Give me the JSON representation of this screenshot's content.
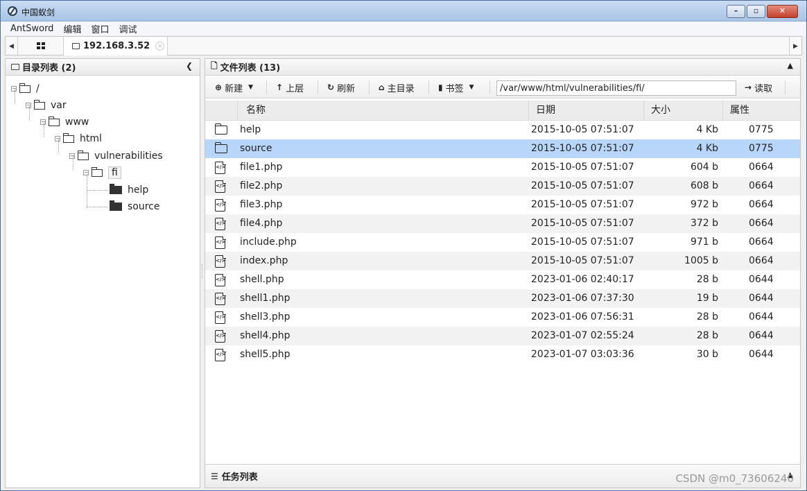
{
  "window": {
    "title": "中国蚁剑"
  },
  "menu": [
    "AntSword",
    "编辑",
    "窗口",
    "调试"
  ],
  "tabs": {
    "active_label": "192.168.3.52"
  },
  "tree_panel": {
    "title": "目录列表 (2)",
    "nodes": [
      {
        "label": "/",
        "depth": 0
      },
      {
        "label": "var",
        "depth": 1
      },
      {
        "label": "www",
        "depth": 2
      },
      {
        "label": "html",
        "depth": 3
      },
      {
        "label": "vulnerabilities",
        "depth": 4
      },
      {
        "label": "fi",
        "depth": 5
      },
      {
        "label": "help",
        "depth": 6
      },
      {
        "label": "source",
        "depth": 6
      }
    ]
  },
  "file_panel": {
    "title": "文件列表 (13)",
    "toolbar": {
      "new_label": "新建",
      "up_label": "上层",
      "refresh_label": "刷新",
      "home_label": "主目录",
      "bookmark_label": "书签",
      "path_value": "/var/www/html/vulnerabilities/fi/",
      "read_label": "读取"
    },
    "columns": [
      "名称",
      "日期",
      "大小",
      "属性"
    ],
    "files": [
      {
        "type": "folder",
        "name": "help",
        "date": "2015-10-05 07:51:07",
        "size": "4 Kb",
        "attr": "0775"
      },
      {
        "type": "folder",
        "name": "source",
        "date": "2015-10-05 07:51:07",
        "size": "4 Kb",
        "attr": "0775",
        "selected": true
      },
      {
        "type": "file",
        "name": "file1.php",
        "date": "2015-10-05 07:51:07",
        "size": "604 b",
        "attr": "0664"
      },
      {
        "type": "file",
        "name": "file2.php",
        "date": "2015-10-05 07:51:07",
        "size": "608 b",
        "attr": "0664"
      },
      {
        "type": "file",
        "name": "file3.php",
        "date": "2015-10-05 07:51:07",
        "size": "972 b",
        "attr": "0664"
      },
      {
        "type": "file",
        "name": "file4.php",
        "date": "2015-10-05 07:51:07",
        "size": "372 b",
        "attr": "0664"
      },
      {
        "type": "file",
        "name": "include.php",
        "date": "2015-10-05 07:51:07",
        "size": "971 b",
        "attr": "0664"
      },
      {
        "type": "file",
        "name": "index.php",
        "date": "2015-10-05 07:51:07",
        "size": "1005 b",
        "attr": "0664"
      },
      {
        "type": "file",
        "name": "shell.php",
        "date": "2023-01-06 02:40:17",
        "size": "28 b",
        "attr": "0644"
      },
      {
        "type": "file",
        "name": "shell1.php",
        "date": "2023-01-06 07:37:30",
        "size": "19 b",
        "attr": "0644"
      },
      {
        "type": "file",
        "name": "shell3.php",
        "date": "2023-01-06 07:56:31",
        "size": "28 b",
        "attr": "0644"
      },
      {
        "type": "file",
        "name": "shell4.php",
        "date": "2023-01-07 02:55:24",
        "size": "28 b",
        "attr": "0644"
      },
      {
        "type": "file",
        "name": "shell5.php",
        "date": "2023-01-07 03:03:36",
        "size": "30 b",
        "attr": "0644"
      }
    ]
  },
  "task_panel": {
    "title": "任务列表"
  },
  "watermark": "CSDN @m0_73606240"
}
